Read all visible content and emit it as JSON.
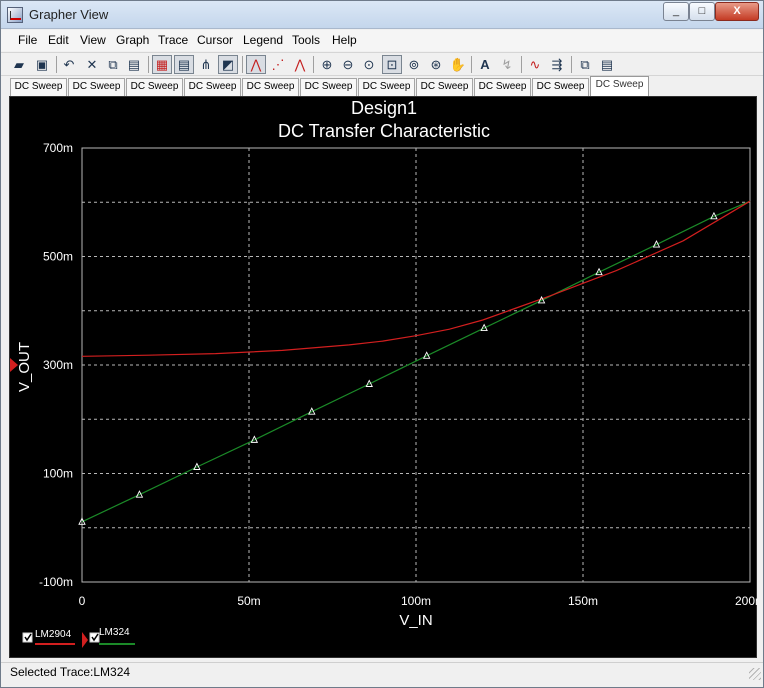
{
  "window": {
    "title": "Grapher View",
    "minimize": "_",
    "maximize": "□",
    "close": "X"
  },
  "menu": [
    "File",
    "Edit",
    "View",
    "Graph",
    "Trace",
    "Cursor",
    "Legend",
    "Tools",
    "Help"
  ],
  "toolbar": {
    "icons": [
      "open-icon",
      "save-icon",
      "undo-icon",
      "cut-icon",
      "copy-icon",
      "paste-icon",
      "grid-toggle-icon",
      "legend-toggle-icon",
      "cursor-toggle-icon",
      "overlay-icon",
      "line-plot-icon",
      "dot-plot-icon",
      "marker-plot-icon",
      "zoom-in-icon",
      "zoom-out-icon",
      "zoom-fit-icon",
      "zoom-area-icon",
      "zoom-x-icon",
      "zoom-y-icon",
      "pan-icon",
      "text-icon",
      "label-icon",
      "trace-icon",
      "export-icon",
      "copy-graph-icon",
      "paste-graph-icon"
    ]
  },
  "tabs": [
    "DC Sweep",
    "DC Sweep",
    "DC Sweep",
    "DC Sweep",
    "DC Sweep",
    "DC Sweep",
    "DC Sweep",
    "DC Sweep",
    "DC Sweep",
    "DC Sweep",
    "DC Sweep"
  ],
  "status": {
    "text": "Selected Trace:LM324"
  },
  "legend": [
    {
      "label": "LM2904",
      "color": "#d21f1f"
    },
    {
      "label": "LM324",
      "color": "#1b8a28"
    }
  ],
  "colors": {
    "plot_bg": "#000000",
    "grid": "#b8b8b8",
    "text": "#ffffff",
    "lm2904": "#d21f1f",
    "lm324": "#1b8a28",
    "marker": "#ffffff"
  },
  "chart_data": {
    "type": "line",
    "title": "Design1",
    "subtitle": "DC Transfer Characteristic",
    "xlabel": "V_IN",
    "ylabel": "V_OUT",
    "xlim": [
      0,
      0.2
    ],
    "ylim": [
      -0.1,
      0.7
    ],
    "x_ticks": [
      0,
      0.05,
      0.1,
      0.15,
      0.2
    ],
    "x_tick_labels": [
      "0",
      "50m",
      "100m",
      "150m",
      "200m"
    ],
    "y_ticks": [
      -0.1,
      0.1,
      0.3,
      0.5,
      0.7
    ],
    "y_tick_labels": [
      "-100m",
      "100m",
      "300m",
      "500m",
      "700m"
    ],
    "grid": true,
    "series": [
      {
        "name": "LM2904",
        "x": [
          0,
          0.02,
          0.04,
          0.06,
          0.08,
          0.09,
          0.1,
          0.11,
          0.12,
          0.13,
          0.14,
          0.16,
          0.18,
          0.2
        ],
        "y": [
          0.316,
          0.318,
          0.321,
          0.327,
          0.337,
          0.344,
          0.354,
          0.366,
          0.383,
          0.405,
          0.427,
          0.474,
          0.529,
          0.602
        ]
      },
      {
        "name": "LM324",
        "x": [
          0,
          0.0172,
          0.0344,
          0.0516,
          0.0688,
          0.086,
          0.1032,
          0.1204,
          0.1376,
          0.1548,
          0.172,
          0.1892,
          0.2
        ],
        "y": [
          0.011,
          0.061,
          0.112,
          0.162,
          0.214,
          0.265,
          0.317,
          0.368,
          0.419,
          0.471,
          0.522,
          0.574,
          0.602
        ],
        "markers": true
      }
    ]
  }
}
